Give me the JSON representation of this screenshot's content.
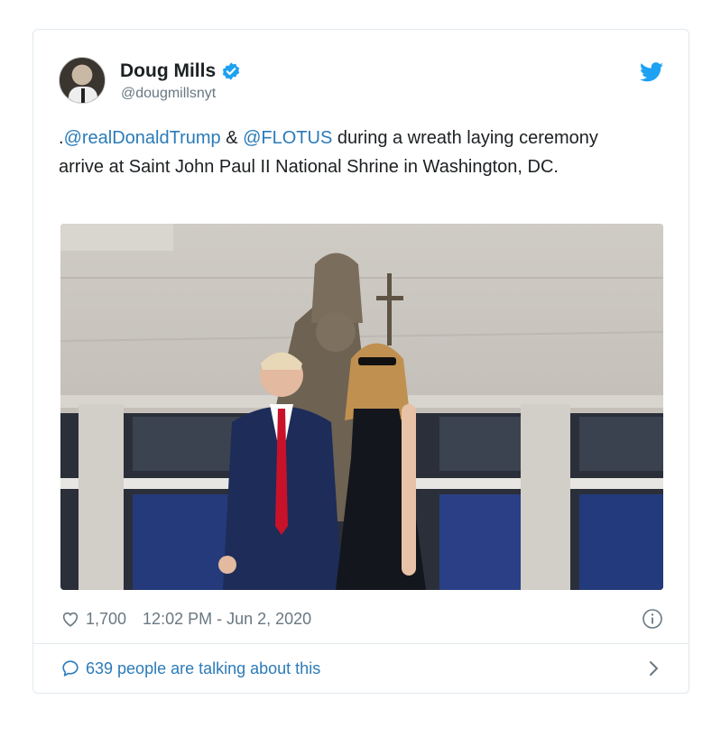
{
  "author": {
    "display_name": "Doug Mills",
    "handle": "@dougmillsnyt",
    "verified": true
  },
  "tweet": {
    "prefix": ".",
    "mention_1": "@realDonaldTrump",
    "joiner": " & ",
    "mention_2": "@FLOTUS",
    "body": "  during a wreath laying ceremony arrive at Saint John Paul II National Shrine in Washington, DC."
  },
  "stats": {
    "likes": "1,700",
    "timestamp": "12:02 PM - Jun 2, 2020"
  },
  "footer": {
    "talking": "639 people are talking about this"
  },
  "colors": {
    "link": "#2b7bb9",
    "twitter_blue": "#1da1f2",
    "muted": "#697882",
    "border": "#e1e8ed"
  },
  "icons": [
    "verified-badge-icon",
    "twitter-bird-icon",
    "heart-icon",
    "info-icon",
    "speech-bubble-icon",
    "chevron-right-icon"
  ]
}
